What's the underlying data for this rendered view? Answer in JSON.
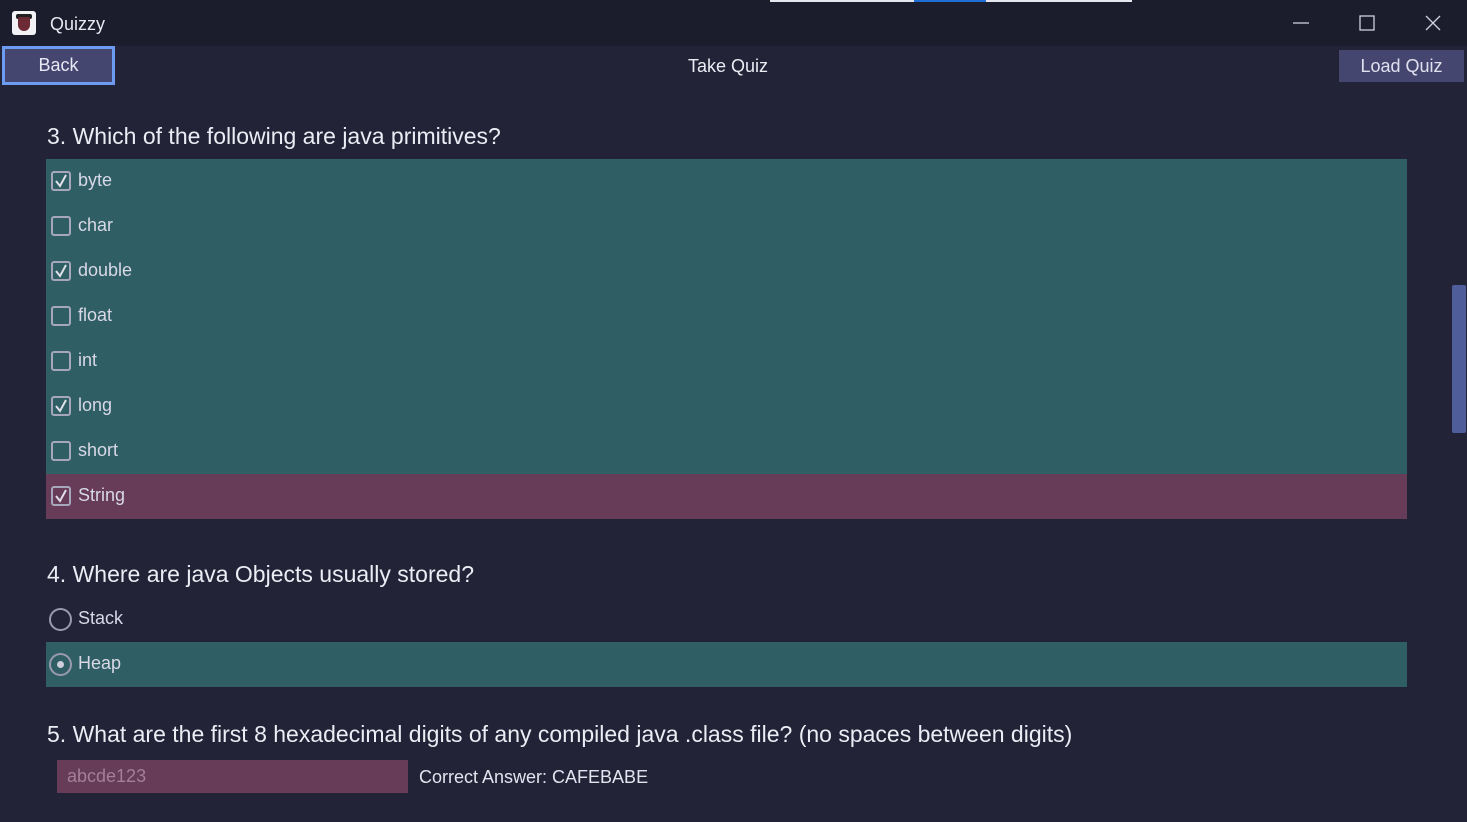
{
  "window": {
    "title": "Quizzy",
    "app_icon": "quizzy-app-icon",
    "controls": [
      "minimize-icon",
      "maximize-icon",
      "close-icon"
    ]
  },
  "toolbar": {
    "back_label": "Back",
    "page_title": "Take Quiz",
    "load_label": "Load Quiz"
  },
  "questions": [
    {
      "text": "3. Which of the following are java primitives?",
      "type": "checkbox",
      "options": [
        {
          "label": "byte",
          "checked": true,
          "status": "correct"
        },
        {
          "label": "char",
          "checked": false,
          "status": "correct"
        },
        {
          "label": "double",
          "checked": true,
          "status": "correct"
        },
        {
          "label": "float",
          "checked": false,
          "status": "correct"
        },
        {
          "label": "int",
          "checked": false,
          "status": "correct"
        },
        {
          "label": "long",
          "checked": true,
          "status": "correct"
        },
        {
          "label": "short",
          "checked": false,
          "status": "correct"
        },
        {
          "label": "String",
          "checked": true,
          "status": "wrong"
        }
      ]
    },
    {
      "text": "4. Where are java Objects usually stored?",
      "type": "radio",
      "options": [
        {
          "label": "Stack",
          "selected": false,
          "status": "none"
        },
        {
          "label": "Heap",
          "selected": true,
          "status": "correct"
        }
      ]
    },
    {
      "text": "5. What are the first 8 hexadecimal digits of any compiled java .class file? (no spaces between digits)",
      "type": "text",
      "answer_value": "abcde123",
      "status": "wrong",
      "correct_answer_text": "Correct Answer: CAFEBABE"
    }
  ],
  "colors": {
    "background": "#222337",
    "titlebar": "#1b1c2c",
    "button": "#45466f",
    "button_focus_border": "#6d9bf1",
    "correct": "#2f5f64",
    "wrong": "#663c58",
    "scrollbar": "#4f5e9a"
  }
}
